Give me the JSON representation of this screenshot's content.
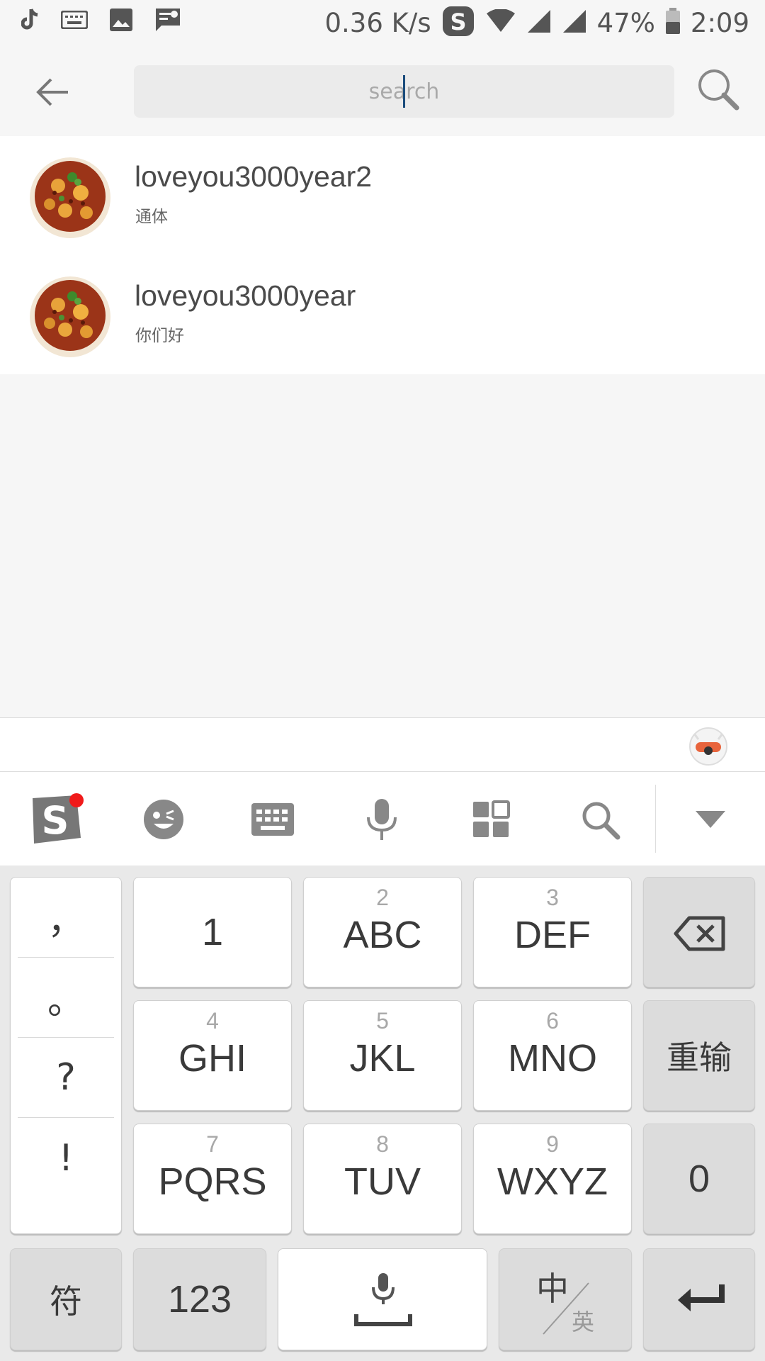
{
  "status_bar": {
    "network_speed": "0.36 K/s",
    "battery": "47%",
    "time": "2:09",
    "icons": [
      "tiktok-icon",
      "keyboard-icon",
      "image-icon",
      "message-icon",
      "sogou-icon",
      "wifi-icon",
      "signal-icon",
      "signal-icon-2",
      "battery-icon"
    ]
  },
  "search": {
    "placeholder": "search",
    "value": ""
  },
  "results": [
    {
      "name": "loveyou3000year2",
      "subtitle": "通体"
    },
    {
      "name": "loveyou3000year",
      "subtitle": "你们好"
    }
  ],
  "keyboard": {
    "punctuation": [
      "，",
      "。",
      "?",
      "!"
    ],
    "row1": [
      {
        "num": "",
        "letters": "1"
      },
      {
        "num": "2",
        "letters": "ABC"
      },
      {
        "num": "3",
        "letters": "DEF"
      }
    ],
    "row2": [
      {
        "num": "4",
        "letters": "GHI"
      },
      {
        "num": "5",
        "letters": "JKL"
      },
      {
        "num": "6",
        "letters": "MNO"
      }
    ],
    "row3": [
      {
        "num": "7",
        "letters": "PQRS"
      },
      {
        "num": "8",
        "letters": "TUV"
      },
      {
        "num": "9",
        "letters": "WXYZ"
      }
    ],
    "reenter": "重输",
    "zero": "0",
    "symbols": "符",
    "num_mode": "123",
    "lang_zh": "中",
    "lang_en": "英"
  },
  "colors": {
    "background": "#f6f6f6",
    "notification_dot": "#f01a1a",
    "icon_gray": "#888888"
  }
}
